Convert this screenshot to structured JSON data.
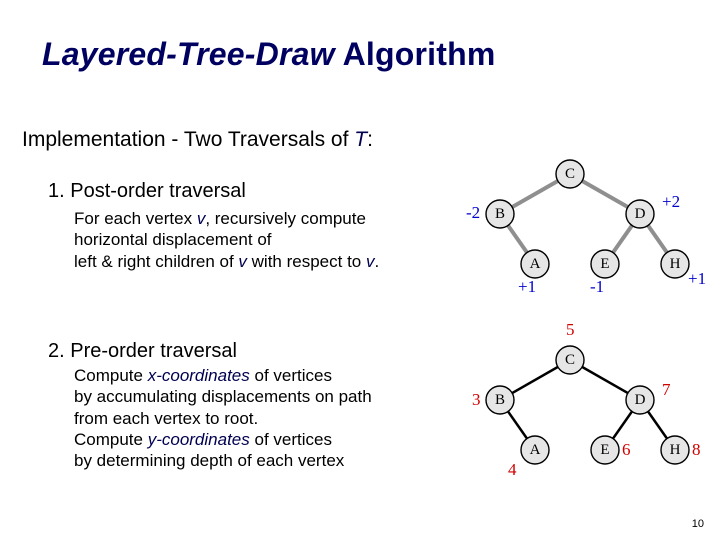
{
  "title_prefix": "Layered-Tree-Draw",
  "title_suffix": " Algorithm",
  "subtitle_prefix": "Implementation - Two Traversals of ",
  "subtitle_var": "T",
  "subtitle_suffix": ":",
  "sec1_head": "1. Post-order traversal",
  "sec1_body_1": "For each vertex ",
  "sec1_body_v1": "v",
  "sec1_body_2": ", recursively compute horizontal displacement of",
  "sec1_body_3": "left & right children of ",
  "sec1_body_v2": "v",
  "sec1_body_4": " with respect to ",
  "sec1_body_v3": "v",
  "sec1_body_5": ".",
  "sec2_head": "2. Pre-order traversal",
  "sec2_body_1a": "Compute ",
  "sec2_body_xc": "x-coordinates",
  "sec2_body_1b": " of vertices",
  "sec2_body_2": "by accumulating displacements on path from each vertex to root.",
  "sec2_body_3a": "Compute ",
  "sec2_body_yc": "y-coordinates",
  "sec2_body_3b": " of vertices",
  "sec2_body_4": "by determining depth of each vertex",
  "page_number": "10",
  "tree_nodes": {
    "C": "C",
    "B": "B",
    "D": "D",
    "A": "A",
    "E": "E",
    "H": "H"
  },
  "fig1_labels": {
    "B": "-2",
    "D": "+2",
    "A": "+1",
    "E": "-1",
    "H": "+1"
  },
  "fig2_labels": {
    "C": "5",
    "B": "3",
    "D": "7",
    "A": "4",
    "E": "6",
    "H": "8"
  },
  "chart_data": [
    {
      "type": "other",
      "title": "Subtree horizontal displacements (post-order)",
      "nodes": [
        "C",
        "B",
        "D",
        "A",
        "E",
        "H"
      ],
      "edges": [
        [
          "C",
          "B"
        ],
        [
          "C",
          "D"
        ],
        [
          "B",
          "A"
        ],
        [
          "D",
          "E"
        ],
        [
          "D",
          "H"
        ]
      ],
      "values": {
        "B": -2,
        "D": 2,
        "A": 1,
        "E": -1,
        "H": 1
      }
    },
    {
      "type": "other",
      "title": "Final x-coordinates (pre-order accumulation)",
      "nodes": [
        "C",
        "B",
        "D",
        "A",
        "E",
        "H"
      ],
      "edges": [
        [
          "C",
          "B"
        ],
        [
          "C",
          "D"
        ],
        [
          "B",
          "A"
        ],
        [
          "D",
          "E"
        ],
        [
          "D",
          "H"
        ]
      ],
      "values": {
        "C": 5,
        "B": 3,
        "D": 7,
        "A": 4,
        "E": 6,
        "H": 8
      }
    }
  ]
}
